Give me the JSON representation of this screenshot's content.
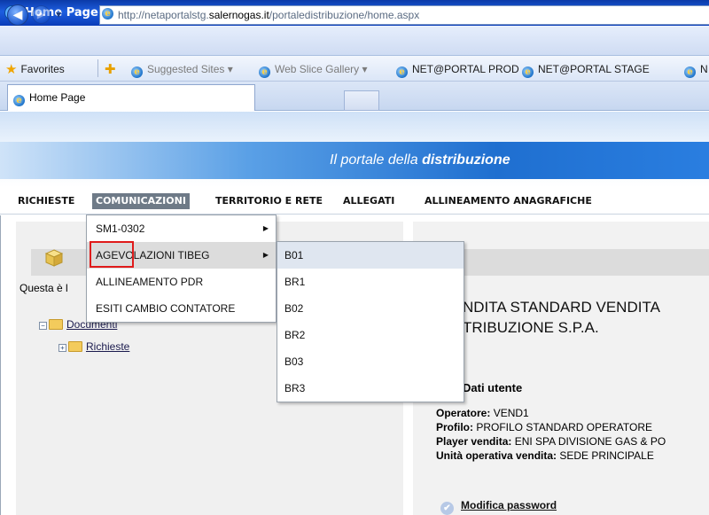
{
  "window": {
    "title": "Home Page - Windows Internet Explorer"
  },
  "address_bar": {
    "url_prefix": "http://netaportalstg.",
    "url_domain": "salernogas.it",
    "url_suffix": "/portaledistribuzione/home.aspx"
  },
  "favorites_bar": {
    "favorites_label": "Favorites",
    "items": [
      {
        "label": "Suggested Sites ▾"
      },
      {
        "label": "Web Slice Gallery ▾"
      },
      {
        "label": "NET@PORTAL PROD"
      },
      {
        "label": "NET@PORTAL STAGE"
      },
      {
        "label": "N"
      }
    ]
  },
  "tabs": [
    {
      "label": "Home Page"
    }
  ],
  "banner": {
    "text_prefix": "Il portale della ",
    "text_bold": "distribuzione"
  },
  "menu": {
    "items": [
      {
        "label": "RICHIESTE"
      },
      {
        "label": "COMUNICAZIONI"
      },
      {
        "label": "TERRITORIO E RETE"
      },
      {
        "label": "ALLEGATI"
      },
      {
        "label": "ALLINEAMENTO ANAGRAFICHE"
      }
    ]
  },
  "dropdown_comunicazioni": [
    {
      "label": "SM1-0302",
      "has_submenu": true
    },
    {
      "label": "AGEVOLAZIONI TIBEG",
      "has_submenu": true
    },
    {
      "label": "ALLINEAMENTO PDR",
      "has_submenu": false
    },
    {
      "label": "ESITI CAMBIO CONTATORE",
      "has_submenu": false
    }
  ],
  "submenu_agevolazioni": [
    "B01",
    "BR1",
    "B02",
    "BR2",
    "B03",
    "BR3"
  ],
  "left_panel": {
    "intro_text": "Questa è l",
    "tree": [
      {
        "label": "Documenti"
      },
      {
        "label": "Richieste"
      }
    ]
  },
  "right_panel": {
    "company_line1": "NDITA STANDARD VENDITA",
    "company_line2": "TRIBUZIONE S.P.A.",
    "user_section_title": "Dati utente",
    "operatore_label": "Operatore:",
    "operatore_value": " VEND1",
    "profilo_label": "Profilo:",
    "profilo_value": " PROFILO STANDARD OPERATORE",
    "player_label": "Player vendita:",
    "player_value": " ENI SPA DIVISIONE GAS & PO",
    "unita_label": "Unità operativa vendita:",
    "unita_value": " SEDE PRINCIPALE",
    "modifica_password": "Modifica password"
  },
  "colors": {
    "titlebar": "#1d5ee0",
    "menu_active": "#6e7a87",
    "highlight_box": "#e01b1b"
  }
}
